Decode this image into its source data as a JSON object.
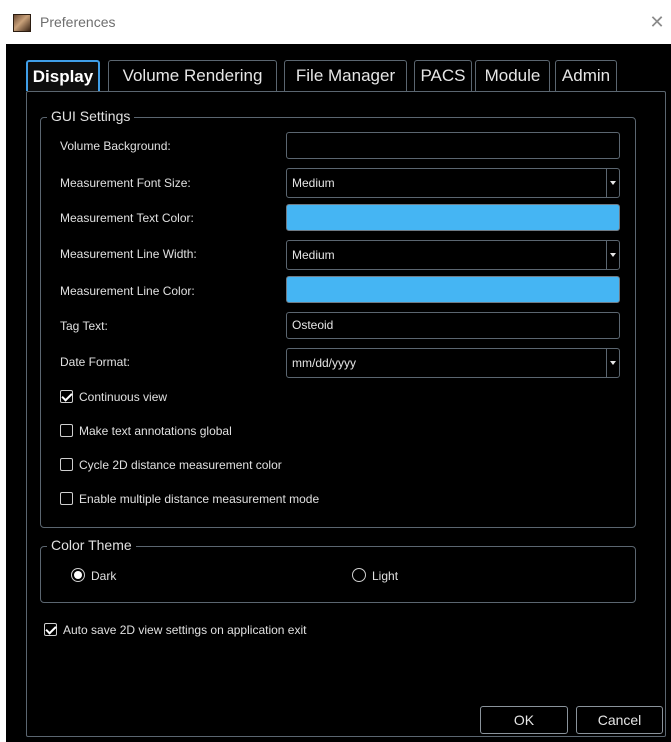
{
  "window": {
    "title": "Preferences",
    "close_glyph": "✕",
    "icon": "app-logo-icon"
  },
  "tabs": [
    {
      "label": "Display",
      "active": true
    },
    {
      "label": "Volume Rendering"
    },
    {
      "label": "File Manager"
    },
    {
      "label": "PACS"
    },
    {
      "label": "Module"
    },
    {
      "label": "Admin"
    }
  ],
  "gui_settings": {
    "title": "GUI Settings",
    "volume_background": {
      "label": "Volume Background:",
      "color": "#000000"
    },
    "measurement_font_size": {
      "label": "Measurement Font Size:",
      "value": "Medium"
    },
    "measurement_text_color": {
      "label": "Measurement Text Color:",
      "color": "#45b5f3"
    },
    "measurement_line_width": {
      "label": "Measurement Line Width:",
      "value": "Medium"
    },
    "measurement_line_color": {
      "label": "Measurement Line Color:",
      "color": "#45b5f3"
    },
    "tag_text": {
      "label": "Tag Text:",
      "value": "Osteoid"
    },
    "date_format": {
      "label": "Date Format:",
      "value": "mm/dd/yyyy"
    },
    "checkboxes": [
      {
        "label": "Continuous view",
        "checked": true
      },
      {
        "label": "Make text annotations global",
        "checked": false
      },
      {
        "label": "Cycle 2D distance measurement color",
        "checked": false
      },
      {
        "label": "Enable multiple distance measurement mode",
        "checked": false
      }
    ]
  },
  "color_theme": {
    "title": "Color Theme",
    "options": [
      {
        "label": "Dark",
        "selected": true
      },
      {
        "label": "Light",
        "selected": false
      }
    ]
  },
  "auto_save": {
    "label": "Auto save 2D view settings on application exit",
    "checked": true
  },
  "buttons": {
    "ok": "OK",
    "cancel": "Cancel"
  },
  "colors": {
    "accent": "#3f9ee8",
    "measurement_blue": "#45b5f3",
    "background": "#000000"
  }
}
